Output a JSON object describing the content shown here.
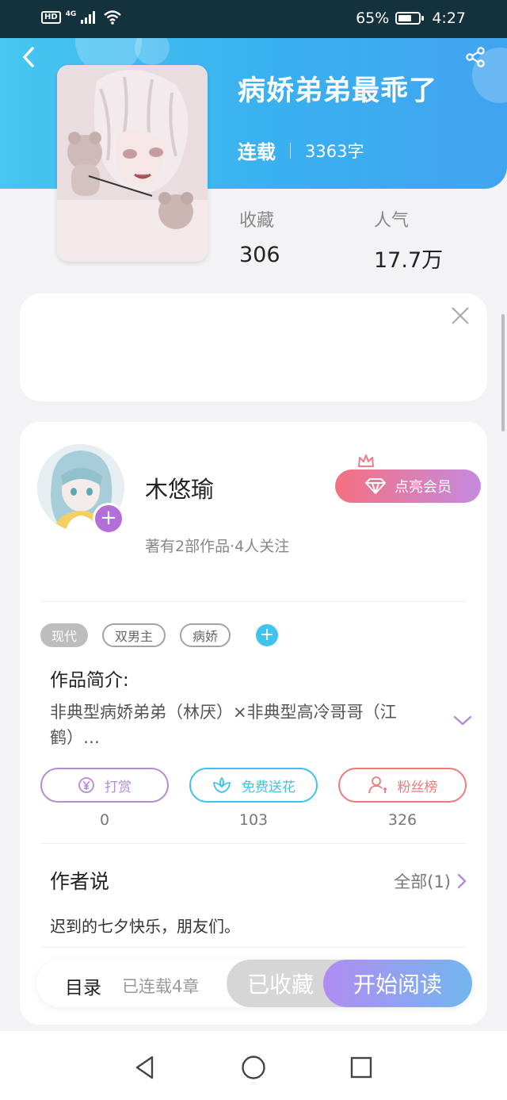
{
  "status_bar": {
    "hd": "HD",
    "network": "4G",
    "battery": "65%",
    "battery_level": 0.65,
    "time": "4:27"
  },
  "book": {
    "title": "病娇弟弟最乖了",
    "serial_status": "连载",
    "word_count": "3363字",
    "favorites_label": "收藏",
    "favorites_value": "306",
    "popularity_label": "人气",
    "popularity_value": "17.7万"
  },
  "author": {
    "name": "木悠瑜",
    "meta": "著有2部作品·4人关注",
    "vip_button": "点亮会员"
  },
  "tags": [
    "现代",
    "双男主",
    "病娇"
  ],
  "intro": {
    "title": "作品简介:",
    "text": "非典型病娇弟弟（林厌）×非典型高冷哥哥（江鹤）…"
  },
  "actions": [
    {
      "label": "打赏",
      "count": "0",
      "color": "#b48ad9"
    },
    {
      "label": "免费送花",
      "count": "103",
      "color": "#3fc3ea"
    },
    {
      "label": "粉丝榜",
      "count": "326",
      "color": "#ee7a7a"
    }
  ],
  "author_says": {
    "title": "作者说",
    "all_label": "全部(1)",
    "text": "迟到的七夕快乐，朋友们。"
  },
  "bottom_bar": {
    "toc_label": "目录",
    "chapter_count": "已连载4章",
    "collected_label": "已收藏",
    "read_label": "开始阅读"
  },
  "colors": {
    "header_blue": "#3ab0f0",
    "accent_purple": "#b36fd8",
    "vip_gradient_start": "#f4707f",
    "read_gradient_start": "#b08cf2"
  },
  "icons": [
    "back-icon",
    "share-icon",
    "close-icon",
    "plus-icon",
    "crown-icon",
    "diamond-icon",
    "yen-icon",
    "flower-icon",
    "user-icon",
    "chevron-down-icon",
    "chevron-right-icon",
    "nav-back-icon",
    "nav-home-icon",
    "nav-recents-icon"
  ]
}
